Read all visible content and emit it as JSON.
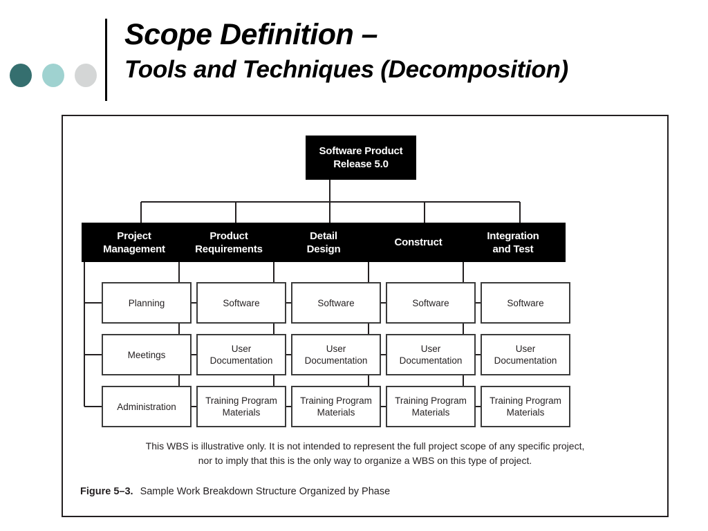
{
  "slide": {
    "title_line_1": "Scope Definition –",
    "title_line_2": "Tools and Techniques (Decomposition)",
    "dots": [
      {
        "name": "dot-dark-teal",
        "color": "#356f6f"
      },
      {
        "name": "dot-light-teal",
        "color": "#9fd2d0"
      },
      {
        "name": "dot-light-gray",
        "color": "#d4d6d6"
      }
    ]
  },
  "figure": {
    "caption_label": "Figure 5–3.",
    "caption_text": "Sample Work Breakdown Structure Organized by Phase",
    "note_line_1": "This WBS is illustrative only. It is not intended to represent the full project scope of any specific project,",
    "note_line_2": "nor to imply that this is the only way to organize a WBS on this type of project."
  },
  "chart_data": {
    "type": "diagram",
    "diagram_type": "work-breakdown-structure",
    "title": "Sample Work Breakdown Structure Organized by Phase",
    "root": {
      "label_line_1": "Software Product",
      "label_line_2": "Release 5.0",
      "style": "black-filled"
    },
    "columns": [
      {
        "header_line_1": "Project",
        "header_line_2": "Management",
        "children": [
          {
            "line_1": "Planning",
            "line_2": ""
          },
          {
            "line_1": "Meetings",
            "line_2": ""
          },
          {
            "line_1": "Administration",
            "line_2": ""
          }
        ]
      },
      {
        "header_line_1": "Product",
        "header_line_2": "Requirements",
        "children": [
          {
            "line_1": "Software",
            "line_2": ""
          },
          {
            "line_1": "User",
            "line_2": "Documentation"
          },
          {
            "line_1": "Training Program",
            "line_2": "Materials"
          }
        ]
      },
      {
        "header_line_1": "Detail",
        "header_line_2": "Design",
        "children": [
          {
            "line_1": "Software",
            "line_2": ""
          },
          {
            "line_1": "User",
            "line_2": "Documentation"
          },
          {
            "line_1": "Training Program",
            "line_2": "Materials"
          }
        ]
      },
      {
        "header_line_1": "Construct",
        "header_line_2": "",
        "children": [
          {
            "line_1": "Software",
            "line_2": ""
          },
          {
            "line_1": "User",
            "line_2": "Documentation"
          },
          {
            "line_1": "Training Program",
            "line_2": "Materials"
          }
        ]
      },
      {
        "header_line_1": "Integration",
        "header_line_2": "and Test",
        "children": [
          {
            "line_1": "Software",
            "line_2": ""
          },
          {
            "line_1": "User",
            "line_2": "Documentation"
          },
          {
            "line_1": "Training Program",
            "line_2": "Materials"
          }
        ]
      }
    ],
    "colors": {
      "node_fill": "#000000",
      "node_text": "#ffffff",
      "leaf_fill": "#ffffff",
      "leaf_border": "#3a3a3a",
      "leaf_text": "#231f20",
      "connector": "#231f20"
    }
  }
}
